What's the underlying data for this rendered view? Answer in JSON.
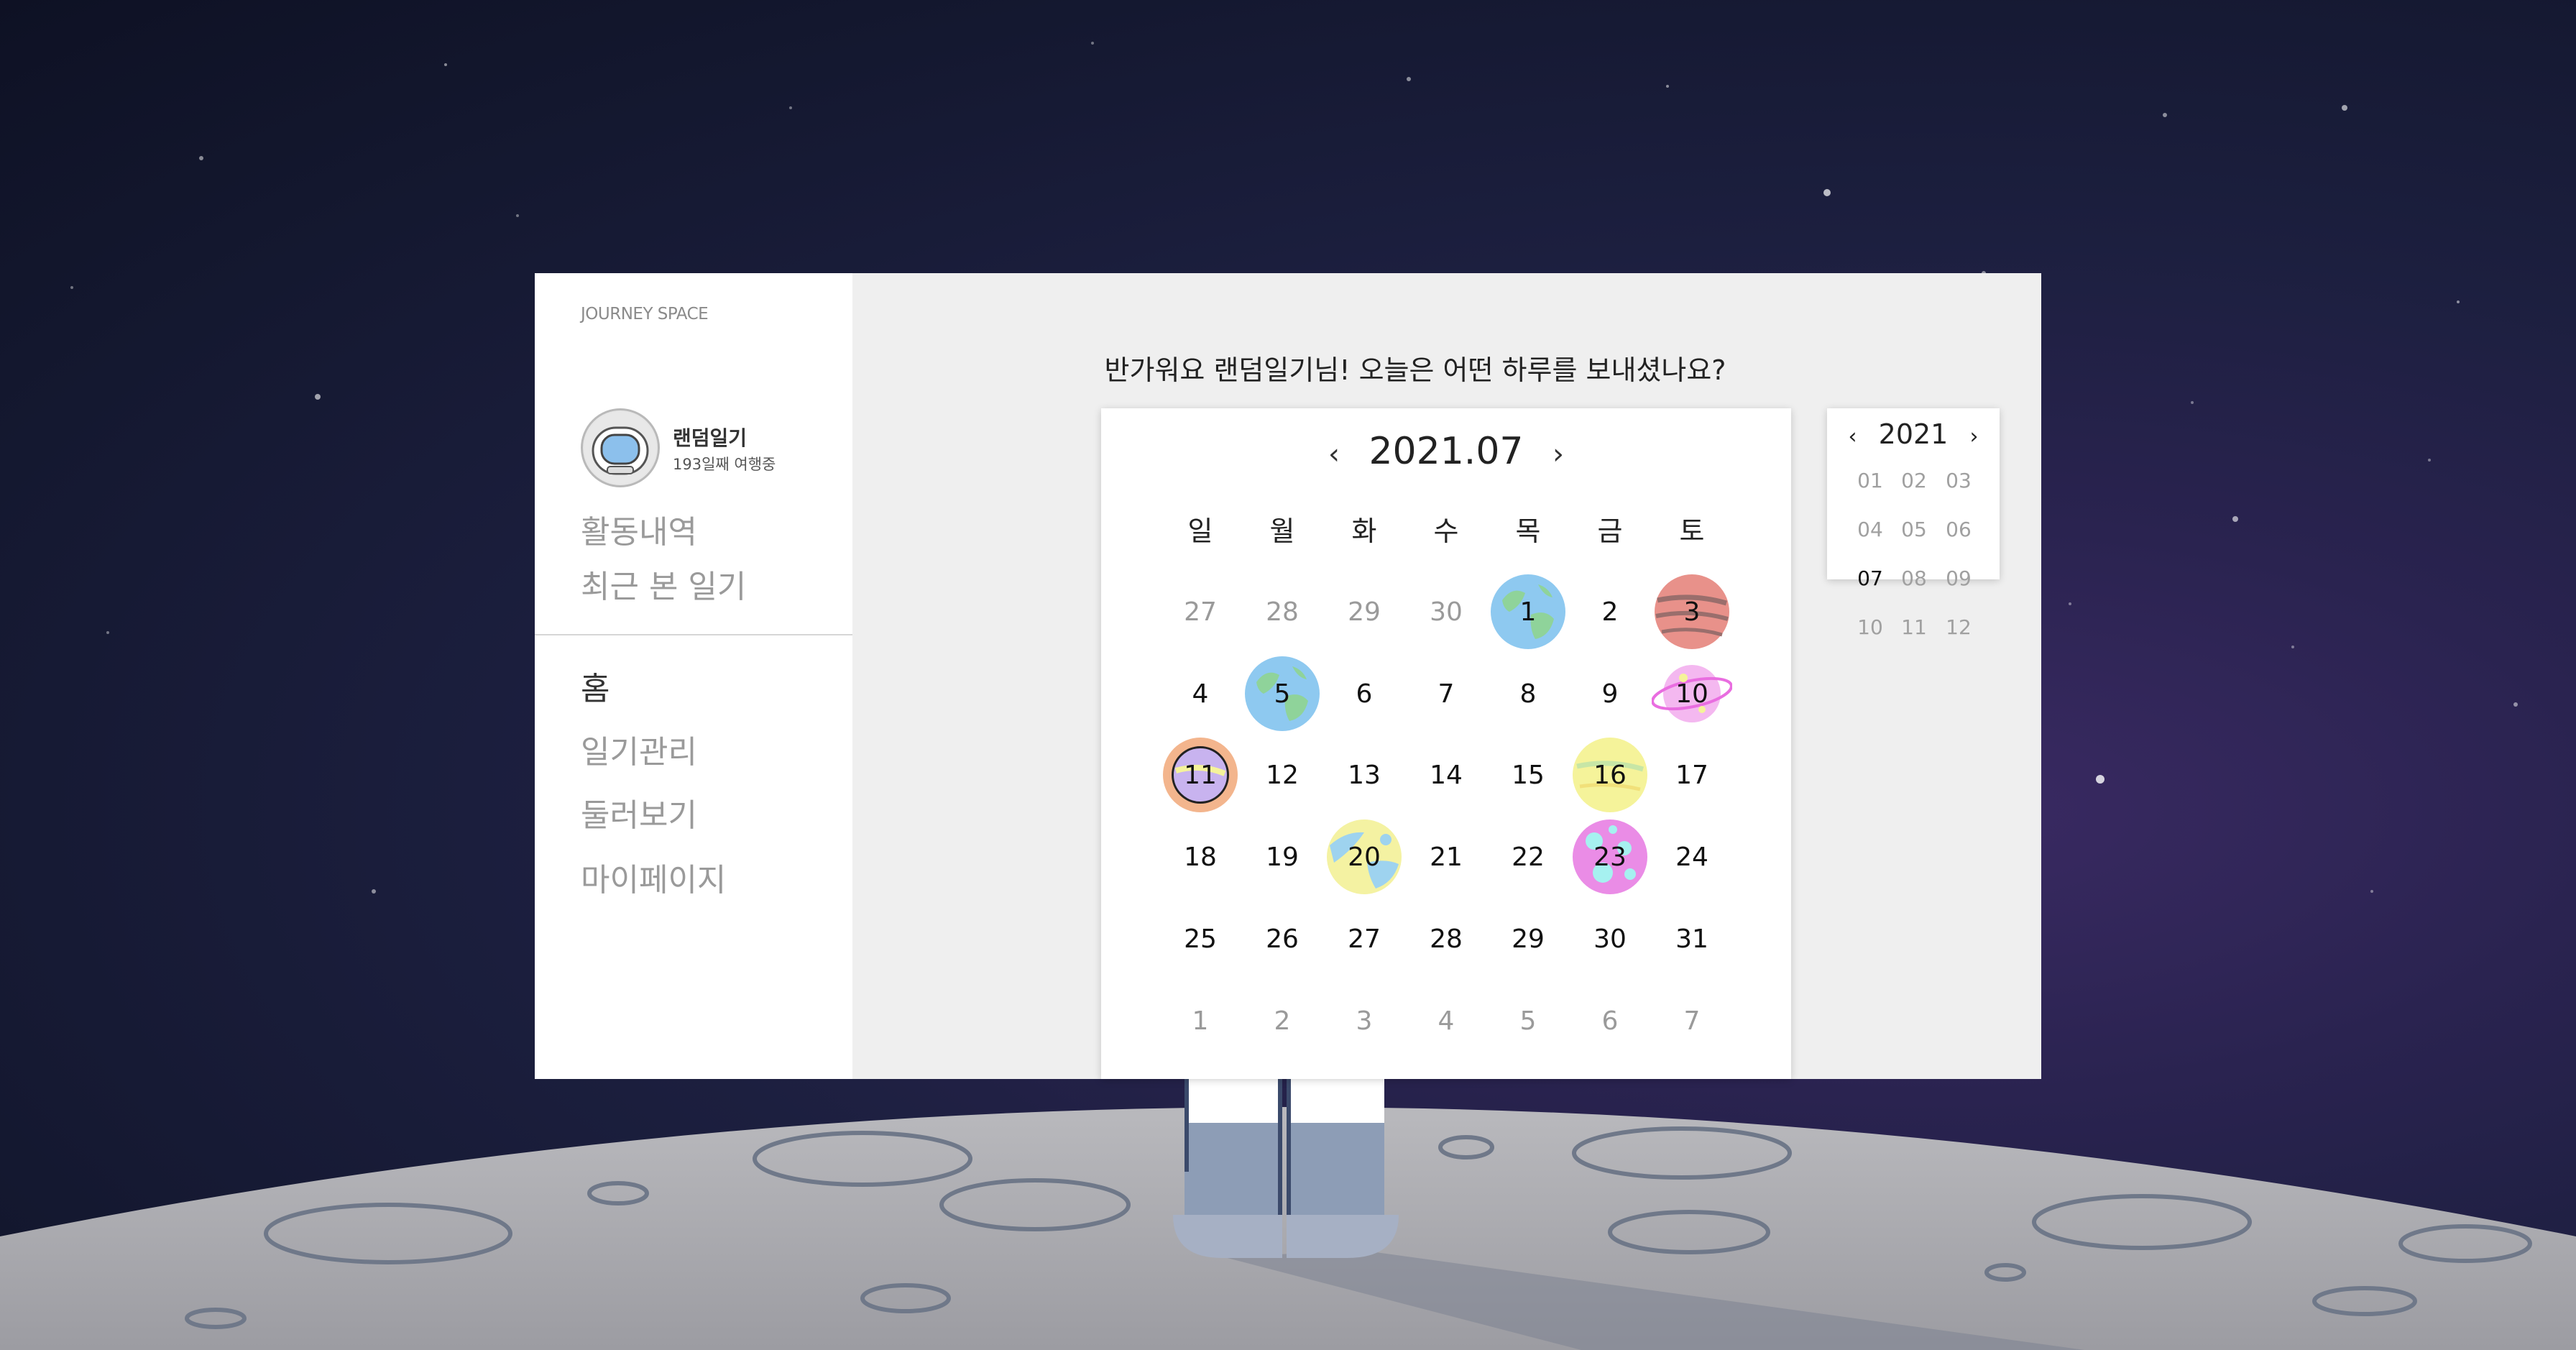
{
  "brand": "JOURNEY SPACE",
  "user": {
    "name": "랜덤일기",
    "status": "193일째 여행중"
  },
  "sub_links": [
    "활동내역",
    "최근 본 일기"
  ],
  "nav": [
    {
      "label": "홈",
      "active": true
    },
    {
      "label": "일기관리",
      "active": false
    },
    {
      "label": "둘러보기",
      "active": false
    },
    {
      "label": "마이페이지",
      "active": false
    }
  ],
  "greeting": "반가워요 랜덤일기님! 오늘은 어떤 하루를 보내셨나요?",
  "calendar": {
    "title": "2021.07",
    "prev_icon": "‹",
    "next_icon": "›",
    "weekdays": [
      "일",
      "월",
      "화",
      "수",
      "목",
      "금",
      "토"
    ],
    "weeks": [
      [
        {
          "d": "27",
          "m": true
        },
        {
          "d": "28",
          "m": true
        },
        {
          "d": "29",
          "m": true
        },
        {
          "d": "30",
          "m": true
        },
        {
          "d": "1",
          "p": "earth"
        },
        {
          "d": "2"
        },
        {
          "d": "3",
          "p": "red-gas-giant"
        }
      ],
      [
        {
          "d": "4"
        },
        {
          "d": "5",
          "p": "earth"
        },
        {
          "d": "6"
        },
        {
          "d": "7"
        },
        {
          "d": "8"
        },
        {
          "d": "9"
        },
        {
          "d": "10",
          "p": "pink-ringed-planet"
        }
      ],
      [
        {
          "d": "11",
          "p": "orange-planet",
          "today": true
        },
        {
          "d": "12"
        },
        {
          "d": "13"
        },
        {
          "d": "14"
        },
        {
          "d": "15"
        },
        {
          "d": "16",
          "p": "yellow-planet"
        },
        {
          "d": "17"
        }
      ],
      [
        {
          "d": "18"
        },
        {
          "d": "19"
        },
        {
          "d": "20",
          "p": "blue-yellow-planet"
        },
        {
          "d": "21"
        },
        {
          "d": "22"
        },
        {
          "d": "23",
          "p": "pink-spotted-planet"
        },
        {
          "d": "24"
        }
      ],
      [
        {
          "d": "25"
        },
        {
          "d": "26"
        },
        {
          "d": "27"
        },
        {
          "d": "28"
        },
        {
          "d": "29"
        },
        {
          "d": "30"
        },
        {
          "d": "31"
        }
      ],
      [
        {
          "d": "1",
          "m": true
        },
        {
          "d": "2",
          "m": true
        },
        {
          "d": "3",
          "m": true
        },
        {
          "d": "4",
          "m": true
        },
        {
          "d": "5",
          "m": true
        },
        {
          "d": "6",
          "m": true
        },
        {
          "d": "7",
          "m": true
        }
      ]
    ]
  },
  "month_picker": {
    "year": "2021",
    "months": [
      "01",
      "02",
      "03",
      "04",
      "05",
      "06",
      "07",
      "08",
      "09",
      "10",
      "11",
      "12"
    ],
    "selected": "07"
  },
  "colors": {
    "earth_ocean": "#8ec9f0",
    "earth_land": "#8fd39a",
    "red_giant": "#e8918a",
    "red_giant_band": "#9a6e6c",
    "pink_planet": "#f4b8f0",
    "pink_ring": "#e96de0",
    "orange_planet": "#f3b58d",
    "orange_inner": "#c8b3ef",
    "yellow_planet": "#f5f39a",
    "yellow_band": "#c7e6a6",
    "blue_yellow_planet": "#f4f2a2",
    "blue_yellow_spot": "#9ed3ef",
    "pink_spotted": "#ea8ce6",
    "pink_spot": "#a6f1f0"
  }
}
